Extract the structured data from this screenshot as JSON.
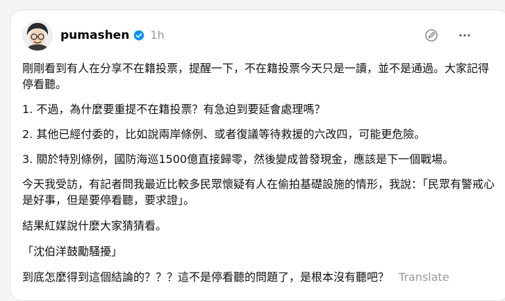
{
  "post": {
    "username": "pumashen",
    "time": "1h",
    "paragraphs": [
      "剛剛看到有人在分享不在籍投票，提醒一下，不在籍投票今天只是一讀，並不是通過。大家記得停看聽。",
      "1. 不過，為什麼要重提不在籍投票？有急迫到要延會處理嗎？",
      "2. 其他已經付委的，比如說兩岸條例、或者復議等待救援的六改四，可能更危險。",
      "3. 關於特別條例，國防海巡1500億直接歸零，然後變成普發現金，應該是下一個戰場。",
      "今天我受訪，有記者問我最近比較多民眾懷疑有人在偷拍基礎設施的情形，我說：「民眾有警戒心是好事，但是要停看聽，要求證」。",
      "結果紅媒說什麼大家猜猜看。",
      "「沈伯洋鼓勵騷擾」",
      "到底怎麼得到這個結論的？？？這不是停看聽的問題了，是根本沒有聽吧？"
    ],
    "translate_label": "Translate"
  },
  "colors": {
    "verified": "#0095f6",
    "muted": "#999999"
  },
  "icons": {
    "verified": "verified-badge-icon",
    "edit": "edit-pencil-icon",
    "more": "more-options-icon"
  }
}
